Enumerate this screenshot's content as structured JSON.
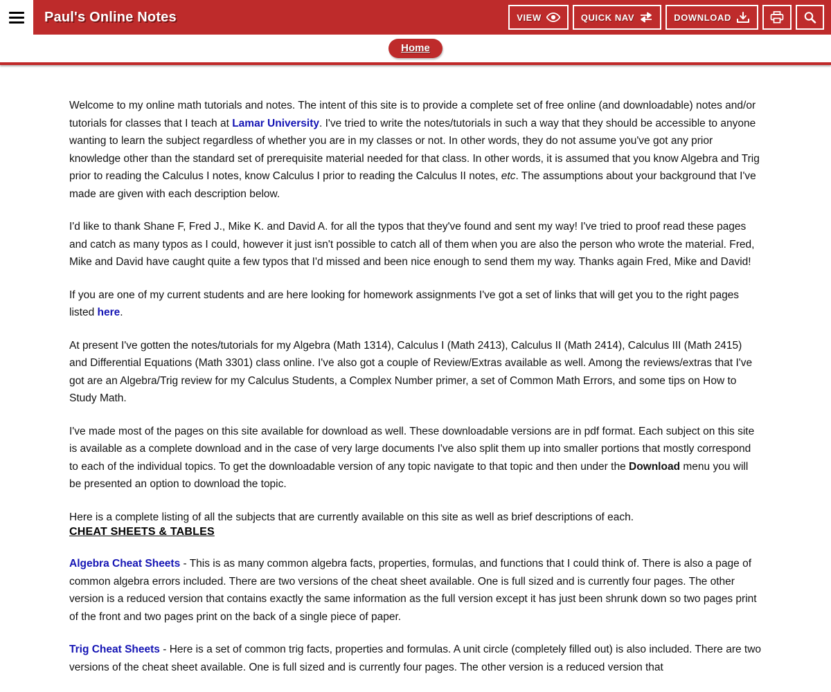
{
  "header": {
    "menu_icon": "hamburger-icon",
    "title": "Paul's Online Notes",
    "buttons": [
      {
        "label": "VIEW",
        "icon": "eye-icon"
      },
      {
        "label": "QUICK NAV",
        "icon": "swap-arrows-icon"
      },
      {
        "label": "DOWNLOAD",
        "icon": "download-icon"
      }
    ],
    "print_icon": "printer-icon",
    "search_icon": "search-icon",
    "accent_color": "#be2b2b"
  },
  "breadcrumb": {
    "items": [
      "Home"
    ]
  },
  "content": {
    "paragraphs": [
      {
        "id": "welcome",
        "parts": [
          {
            "t": "Welcome to my online math tutorials and notes. The intent of this site is to provide a complete set of free online (and downloadable) notes and/or tutorials for classes that I teach at ",
            "style": "plain"
          },
          {
            "t": "Lamar University",
            "style": "link"
          },
          {
            "t": ". I've tried to write the notes/tutorials in such a way that they should be accessible to anyone wanting to learn the subject regardless of whether you are in my classes or not. In other words, they do not assume you've got any prior knowledge other than the standard set of prerequisite material needed for that class. In other words, it is assumed that you know Algebra and Trig prior to reading the Calculus I notes, know Calculus I prior to reading the Calculus II notes, ",
            "style": "plain"
          },
          {
            "t": "etc",
            "style": "italic"
          },
          {
            "t": ". The assumptions about your background that I've made are given with each description below.",
            "style": "plain"
          }
        ]
      },
      {
        "id": "thanks",
        "parts": [
          {
            "t": "I'd like to thank Shane F, Fred J., Mike K. and David A. for all the typos that they've found and sent my way! I've tried to proof read these pages and catch as many typos as I could, however it just isn't possible to catch all of them when you are also the person who wrote the material. Fred, Mike and David have caught quite a few typos that I'd missed and been nice enough to send them my way. Thanks again Fred, Mike and David!",
            "style": "plain"
          }
        ]
      },
      {
        "id": "homework-links",
        "parts": [
          {
            "t": "If you are one of my current students and are here looking for homework assignments I've got a set of links that will get you to the right pages listed ",
            "style": "plain"
          },
          {
            "t": "here",
            "style": "link"
          },
          {
            "t": ".",
            "style": "plain"
          }
        ]
      },
      {
        "id": "available-classes",
        "parts": [
          {
            "t": "At present I've gotten the notes/tutorials for my Algebra (Math 1314), Calculus I (Math 2413), Calculus II (Math 2414), Calculus III (Math 2415) and Differential Equations (Math 3301) class online. I've also got a couple of Review/Extras available as well. Among the reviews/extras that I've got are an Algebra/Trig review for my Calculus Students, a Complex Number primer, a set of Common Math Errors, and some tips on How to Study Math.",
            "style": "plain"
          }
        ]
      },
      {
        "id": "downloads",
        "parts": [
          {
            "t": "I've made most of the pages on this site available for download as well. These downloadable versions are in pdf format. Each subject on this site is available as a complete download and in the case of very large documents I've also split them up into smaller portions that mostly correspond to each of the individual topics. To get the downloadable version of any topic navigate to that topic and then under the ",
            "style": "plain"
          },
          {
            "t": "Download",
            "style": "bold"
          },
          {
            "t": " menu you will be presented an option to download the topic.",
            "style": "plain"
          }
        ]
      },
      {
        "id": "listing-intro",
        "parts": [
          {
            "t": "Here is a complete listing of all the subjects that are currently available on this site as well as brief descriptions of each.",
            "style": "plain"
          }
        ]
      }
    ],
    "section_heading": "CHEAT SHEETS & TABLES",
    "entries": [
      {
        "id": "algebra-cheat-sheets",
        "parts": [
          {
            "t": "Algebra Cheat Sheets",
            "style": "link"
          },
          {
            "t": " - This is as many common algebra facts, properties, formulas, and functions that I could think of. There is also a page of common algebra errors included. There are two versions of the cheat sheet available. One is full sized and is currently four pages. The other version is a reduced version that contains exactly the same information as the full version except it has just been shrunk down so two pages print of the front and two pages print on the back of a single piece of paper.",
            "style": "plain"
          }
        ]
      },
      {
        "id": "trig-cheat-sheets",
        "parts": [
          {
            "t": "Trig Cheat Sheets",
            "style": "link"
          },
          {
            "t": " - Here is a set of common trig facts, properties and formulas. A unit circle (completely filled out) is also included. There are two versions of the cheat sheet available. One is full sized and is currently four pages. The other version is a reduced version that",
            "style": "plain"
          }
        ]
      }
    ]
  }
}
